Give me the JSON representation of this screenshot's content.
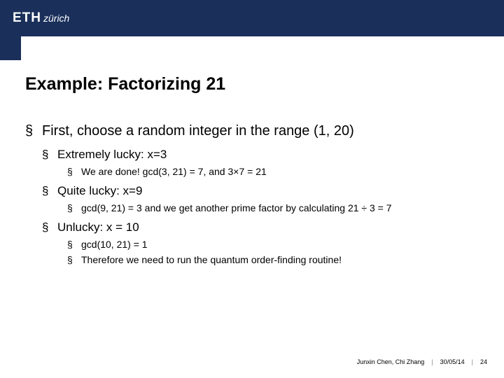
{
  "header": {
    "logo_eth": "ETH",
    "logo_zurich": "zürich"
  },
  "title": "Example: Factorizing 21",
  "bullets": {
    "l1_a": "First, choose a random integer in the range (1, 20)",
    "l2_a": "Extremely lucky: x=3",
    "l3_a": "We are done! gcd(3, 21) = 7, and 3×7 = 21",
    "l2_b": "Quite lucky: x=9",
    "l3_b": "gcd(9, 21) = 3 and we get another prime factor by calculating 21 ÷ 3 = 7",
    "l2_c": "Unlucky: x = 10",
    "l3_c": "gcd(10, 21) = 1",
    "l3_d": "Therefore we need to run the quantum order-finding routine!"
  },
  "footer": {
    "authors": "Junxin Chen, Chi Zhang",
    "date": "30/05/14",
    "page": "24"
  }
}
